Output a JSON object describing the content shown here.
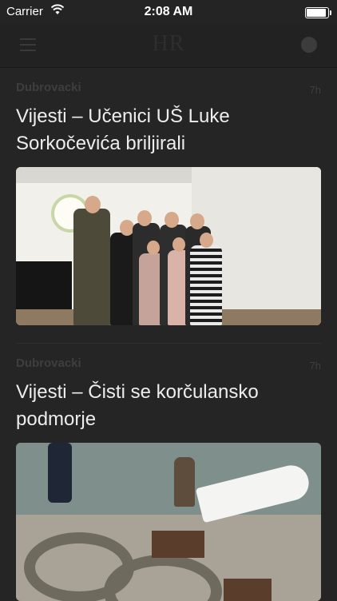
{
  "status_bar": {
    "carrier": "Carrier",
    "time": "2:08 AM"
  },
  "nav": {
    "logo": "HR",
    "menu_icon": "hamburger-menu-icon",
    "profile_icon": "profile-dot-icon"
  },
  "articles": [
    {
      "source": "Dubrovacki",
      "age": "7h",
      "title": "Vijesti – Učenici UŠ Luke Sorkočevića briljirali",
      "image_desc": "group-photo"
    },
    {
      "source": "Dubrovacki",
      "age": "7h",
      "title": "Vijesti – Čisti se korčulansko podmorje",
      "image_desc": "harbor-photo"
    }
  ],
  "colors": {
    "background": "#252525",
    "nav_background": "#222222",
    "title_text": "#ededed",
    "meta_text": "#3e3e3e"
  }
}
